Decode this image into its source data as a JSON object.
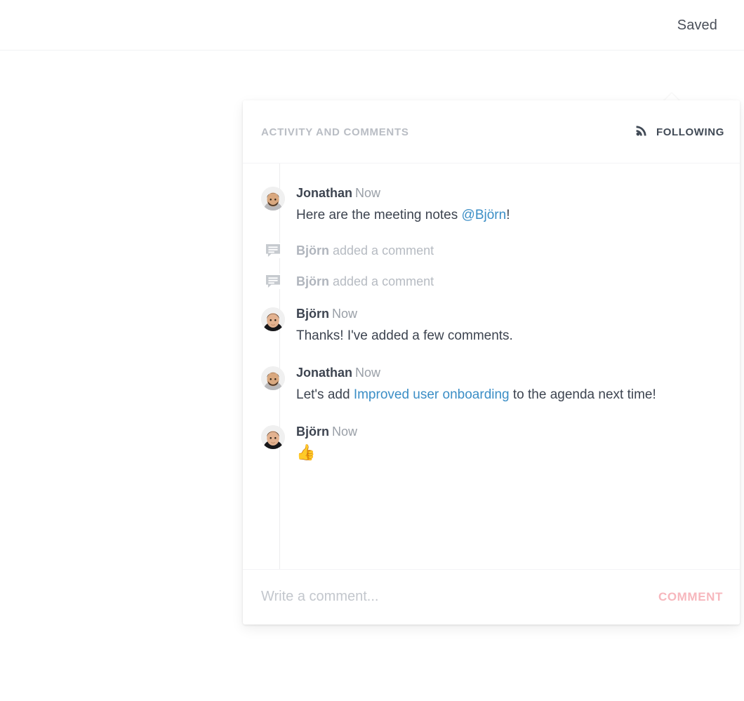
{
  "topbar": {
    "status_label": "Saved"
  },
  "toolbar": {
    "avatar": {
      "name": "avatar",
      "online": true,
      "online_color": "#5bcc33"
    },
    "comments_icon": "comments-icon",
    "more_icon": "more-vertical-icon"
  },
  "panel": {
    "title": "ACTIVITY AND COMMENTS",
    "following": {
      "label": "FOLLOWING",
      "icon": "rss-feed-icon"
    },
    "feed": [
      {
        "kind": "comment",
        "author": "Jonathan",
        "time": "Now",
        "avatar": "jonathan",
        "parts": [
          {
            "type": "text",
            "value": "Here are the meeting notes "
          },
          {
            "type": "link",
            "value": "@Björn"
          },
          {
            "type": "text",
            "value": "!"
          }
        ]
      },
      {
        "kind": "activity",
        "icon": "comment-bubble-icon",
        "name": "Björn",
        "action": " added a comment"
      },
      {
        "kind": "activity",
        "icon": "comment-bubble-icon",
        "name": "Björn",
        "action": " added a comment"
      },
      {
        "kind": "comment",
        "author": "Björn",
        "time": "Now",
        "avatar": "bjorn",
        "parts": [
          {
            "type": "text",
            "value": "Thanks! I've added a few comments."
          }
        ]
      },
      {
        "kind": "comment",
        "author": "Jonathan",
        "time": "Now",
        "avatar": "jonathan",
        "parts": [
          {
            "type": "text",
            "value": "Let's add "
          },
          {
            "type": "link",
            "value": "Improved user onboarding"
          },
          {
            "type": "text",
            "value": " to the agenda next time!"
          }
        ]
      },
      {
        "kind": "comment",
        "author": "Björn",
        "time": "Now",
        "avatar": "bjorn",
        "parts": [
          {
            "type": "emoji",
            "value": "👍"
          }
        ]
      }
    ],
    "composer": {
      "placeholder": "Write a comment...",
      "value": "",
      "submit_label": "COMMENT",
      "submit_color": "#f7b7bd"
    }
  },
  "colors": {
    "link": "#3b8ec6",
    "text": "#3d4450",
    "muted": "#9aa0a8",
    "faint": "#b6bbc2"
  }
}
